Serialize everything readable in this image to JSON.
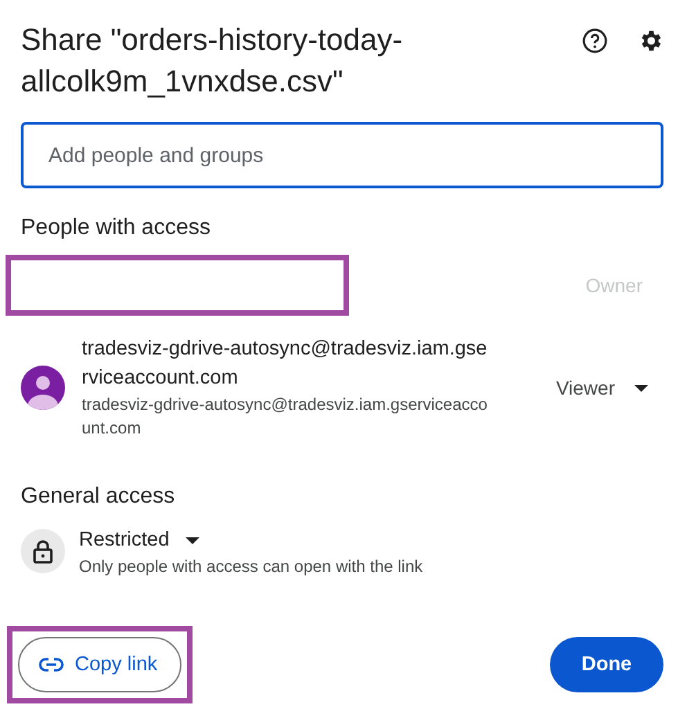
{
  "dialog": {
    "title": "Share \"orders-history-today-allcolk9m_1vnxdse.csv\""
  },
  "search": {
    "placeholder": "Add people and groups",
    "focused": true
  },
  "people_section": {
    "heading": "People with access"
  },
  "people": [
    {
      "kind": "redacted",
      "role": "Owner",
      "role_disabled": true
    },
    {
      "kind": "account",
      "name": "tradesviz-gdrive-autosync@tradesviz.iam.gserviceaccount.com",
      "email": "tradesviz-gdrive-autosync@tradesviz.iam.gserviceaccount.com",
      "role": "Viewer",
      "role_disabled": false
    }
  ],
  "general_access": {
    "heading": "General access",
    "level_name": "Restricted",
    "description": "Only people with access can open with the link"
  },
  "footer": {
    "copy_link": {
      "label": "Copy link",
      "highlighted": true
    },
    "done": {
      "label": "Done"
    }
  }
}
